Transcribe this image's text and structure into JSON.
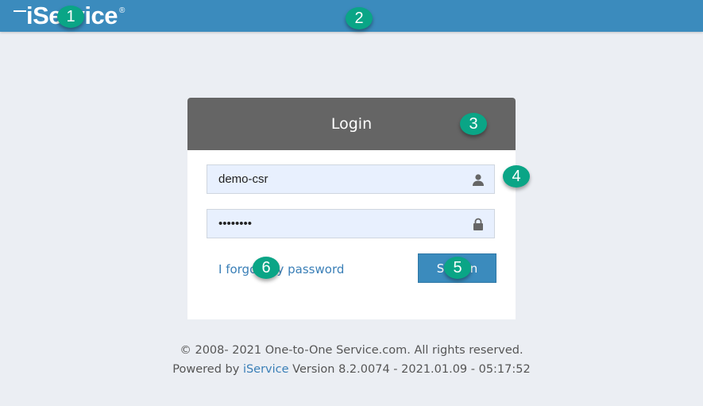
{
  "header": {
    "logo_text": "iService",
    "logo_mark": "®"
  },
  "login": {
    "title": "Login",
    "username_value": "demo-csr",
    "password_value": "••••••••",
    "user_icon": "user-icon",
    "lock_icon": "lock-icon",
    "forgot_label": "I forgot my password",
    "signin_label": "Sign In"
  },
  "footer": {
    "copyright": "© 2008- 2021 One-to-One Service.com. All rights reserved.",
    "powered_prefix": "Powered by ",
    "powered_link": "iService",
    "version": " Version 8.2.0074 - 2021.01.09 - 05:17:52"
  },
  "badges": [
    "1",
    "2",
    "3",
    "4",
    "5",
    "6"
  ],
  "colors": {
    "header": "#3b8bbd",
    "card_head": "#656565",
    "badge": "#0aa586"
  }
}
